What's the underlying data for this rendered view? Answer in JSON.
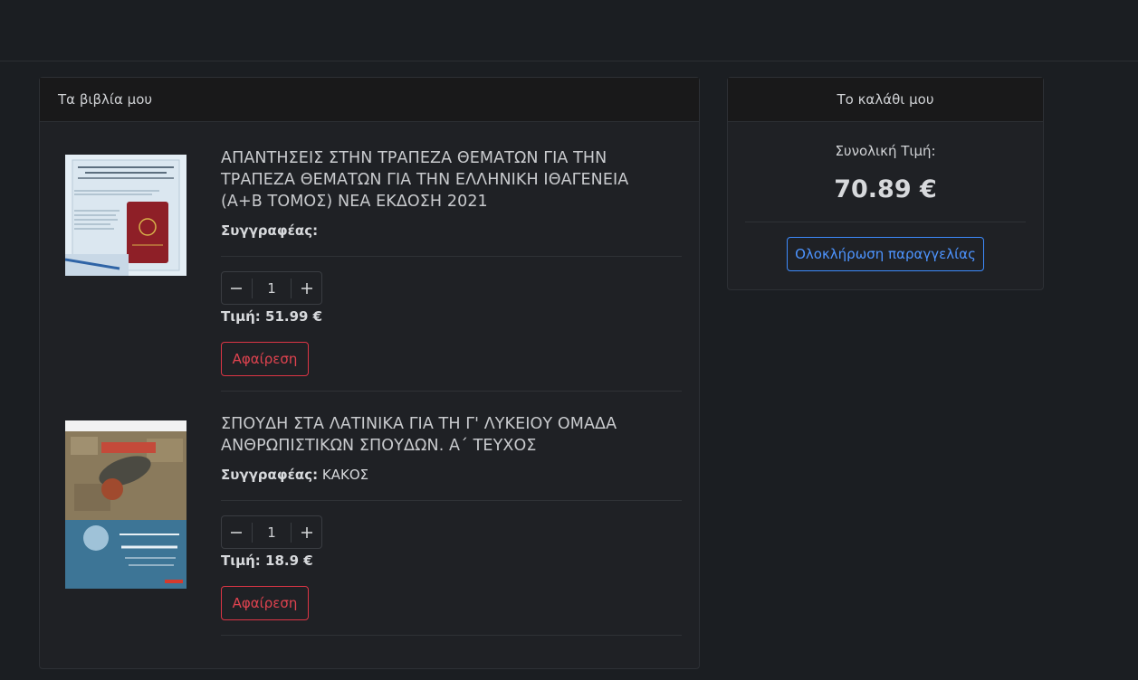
{
  "books_panel": {
    "header": "Τα βιβλία μου"
  },
  "items": [
    {
      "title": "ΑΠΑΝΤΗΣΕΙΣ ΣΤΗΝ ΤΡΑΠΕΖΑ ΘΕΜΑΤΩΝ ΓΙΑ ΤΗΝ ΤΡΑΠΕΖΑ ΘΕΜΑΤΩΝ ΓΙΑ ΤΗΝ ΕΛΛΗΝΙΚΗ ΙΘΑΓΕΝΕΙΑ (Α+Β ΤΟΜΟΣ) ΝΕΑ ΕΚΔΟΣΗ 2021",
      "author_label": "Συγγραφέας:",
      "author": "",
      "quantity": "1",
      "price_label": "Τιμή: 51.99 €",
      "remove_label": "Αφαίρεση",
      "cover_text": "Απαντήσεις στην Τράπεζα θεμάτων για την ελληνική ιθαγένεια"
    },
    {
      "title": "ΣΠΟΥΔΗ ΣΤΑ ΛΑΤΙΝΙΚΑ ΓΙΑ ΤΗ Γ' ΛΥΚΕΙΟΥ ΟΜΑΔΑ ΑΝΘΡΩΠΙΣΤΙΚΩΝ ΣΠΟΥΔΩΝ. Α΄ ΤΕΥΧΟΣ",
      "author_label": "Συγγραφέας:",
      "author": "ΚΑΚΟΣ",
      "quantity": "1",
      "price_label": "Τιμή: 18.9 €",
      "remove_label": "Αφαίρεση",
      "cover_text": "ΣΠΟΥΔΗ ΣΤΑ ΛΑΤΙΝΙΚΑ ΓΙΑ ΤΗ Γ' ΛΥΚΕΙΟΥ"
    }
  ],
  "cart": {
    "header": "Το καλάθι μου",
    "total_label": "Συνολική Τιμή:",
    "total_value": "70.89 €",
    "checkout_label": "Ολοκλήρωση παραγγελίας"
  },
  "colors": {
    "background": "#1b1e22",
    "danger": "#dc3545",
    "primary": "#3d8bfd"
  }
}
